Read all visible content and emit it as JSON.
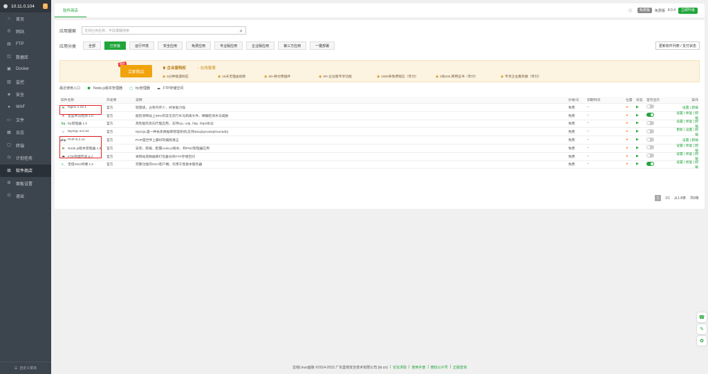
{
  "sidebar": {
    "server_ip": "10.11.0.104",
    "badge": "0",
    "items": [
      {
        "label": "首页",
        "icon": "home-icon",
        "glyph": "⌂"
      },
      {
        "label": "网站",
        "icon": "globe-icon",
        "glyph": "◎"
      },
      {
        "label": "FTP",
        "icon": "ftp-icon",
        "glyph": "▤"
      },
      {
        "label": "数据库",
        "icon": "database-icon",
        "glyph": "◫"
      },
      {
        "label": "Docker",
        "icon": "docker-icon",
        "glyph": "▣"
      },
      {
        "label": "监控",
        "icon": "monitor-icon",
        "glyph": "▥"
      },
      {
        "label": "安全",
        "icon": "shield-icon",
        "glyph": "◈"
      },
      {
        "label": "WAF",
        "icon": "waf-icon",
        "glyph": "●"
      },
      {
        "label": "文件",
        "icon": "folder-icon",
        "glyph": "▭"
      },
      {
        "label": "日志",
        "icon": "log-icon",
        "glyph": "▦"
      },
      {
        "label": "终端",
        "icon": "terminal-icon",
        "glyph": "▢"
      },
      {
        "label": "计划任务",
        "icon": "clock-icon",
        "glyph": "◷"
      },
      {
        "label": "软件商店",
        "icon": "grid-icon",
        "glyph": "▩",
        "active": true
      },
      {
        "label": "面板设置",
        "icon": "gear-icon",
        "glyph": "⚙"
      },
      {
        "label": "退出",
        "icon": "logout-icon",
        "glyph": "⏻"
      }
    ],
    "footer": "自定义菜单"
  },
  "topbar": {
    "tab": "软件商店",
    "edition_badge": "免费版",
    "version_label": "免费版",
    "version": "8.0.4",
    "upgrade": "立即升级"
  },
  "search": {
    "label": "应用搜索",
    "placeholder": "支持应用名称、字段模糊搜索"
  },
  "categories": {
    "label": "应用分类",
    "items": [
      {
        "label": "全部"
      },
      {
        "label": "已安装",
        "active": true
      },
      {
        "label": "运行环境"
      },
      {
        "label": "安全应用"
      },
      {
        "label": "免费应用"
      },
      {
        "label": "专业版应用"
      },
      {
        "label": "企业版应用"
      },
      {
        "label": "第三方应用"
      },
      {
        "label": "一键部署"
      }
    ],
    "refresh": "更新软件列表 / 支付状态"
  },
  "banner": {
    "buy_tag": "限时",
    "buy_label": "立即购买",
    "title1": "企业版特权",
    "title2": "在线客服",
    "features": [
      "5分钟极速响应",
      "15天无理由退款",
      "30+款付费插件",
      "20+企业版专享功能",
      "1000条免费短信（年付）",
      "2张SSL商用证书（年付）",
      "专享企业服务群（年付）"
    ]
  },
  "recent": {
    "label": "最近使用入口",
    "items": [
      {
        "label": "Node.js版本管理器",
        "icon": "nodejs-icon"
      },
      {
        "label": "frp管理器",
        "icon": "frp-icon"
      },
      {
        "label": "FTP存储空间",
        "icon": "cloud-icon"
      }
    ]
  },
  "table": {
    "headers": {
      "name": "软件名称",
      "dev": "开发商",
      "desc": "说明",
      "price": "价格/天",
      "expire": "到期时间",
      "pos": "位置",
      "status": "状态",
      "home": "首页显示",
      "ops": "操作"
    },
    "rows": [
      {
        "name": "Nginx 1.22.1",
        "icon": "nginx-icon",
        "icon_text": "N",
        "icon_color": "#2e9a3e",
        "dev": "官方",
        "desc": "轻量级，占有内存少，并发能力强",
        "price": "免费",
        "expire": "--",
        "home_on": false,
        "ops": "设置 | 卸载"
      },
      {
        "name": "堡垒木马检测 1.0",
        "icon": "trojan-icon",
        "icon_text": "A",
        "icon_color": "#c0392b",
        "dev": "官方",
        "desc": "能检测网站上99%的常见流行木马病毒文件、精确检测木马威胁",
        "price": "免费",
        "expire": "--",
        "home_on": true,
        "ops": "设置 | 修复 | 卸载"
      },
      {
        "name": "frp管理器 1.0",
        "icon": "frp-icon",
        "icon_text": "frp",
        "icon_color": "#20a53a",
        "dev": "官方",
        "desc": "高性能的反向代理应用，支持tcp, udp, http, https协议",
        "price": "免费",
        "expire": "--",
        "home_on": false,
        "ops": "设置 | 修复 | 卸载"
      },
      {
        "name": "MySQL 8.0.34",
        "icon": "mysql-icon",
        "icon_text": "≈",
        "icon_color": "#5b7fa6",
        "dev": "官方",
        "desc": "MySQL是一种关系数据库管理系统(支持alisql/greatsql/mariadb)",
        "price": "免费",
        "expire": "--",
        "home_on": false,
        "ops": "更新 | 设置 | 卸载"
      },
      {
        "name": "PHP-8.2.12",
        "icon": "php-icon",
        "icon_text": "php",
        "icon_color": "#555",
        "dev": "官方",
        "desc": "PHP是世界上最好的编程语言",
        "price": "免费",
        "expire": "--",
        "home_on": false,
        "ops": "设置 | 卸载"
      },
      {
        "name": "Node.js版本管理器 1.9",
        "icon": "nodejs-icon",
        "icon_text": "N",
        "icon_color": "#3c873a",
        "dev": "官方",
        "desc": "安装、卸载、配置node.js版本、和PM2管理器应用",
        "price": "免费",
        "expire": "--",
        "home_on": false,
        "ops": "设置 | 修复 | 卸载"
      },
      {
        "name": "FTP存储空间 5.7",
        "icon": "cloud-icon",
        "icon_text": "☁",
        "icon_color": "#333",
        "dev": "官方",
        "desc": "将网站或数据库打包备份到FTP存储空间",
        "price": "免费",
        "expire": "--",
        "home_on": false,
        "ops": "设置 | 修复 | 卸载"
      },
      {
        "name": "宝塔SSH终端 1.0",
        "icon": "ssh-icon",
        "icon_text": ">_",
        "icon_color": "#20a53a",
        "dev": "官方",
        "desc": "完整功能的SSH客户端，仅用于连接本服务器",
        "price": "免费",
        "expire": "--",
        "home_on": true,
        "ops": "设置 | 修复 | 卸载"
      }
    ]
  },
  "pager": {
    "current": "1",
    "pages": "1/1",
    "range": "从1-8条",
    "total": "共8条"
  },
  "footer": {
    "copyright": "宝塔Linux面板 ©2014-2023 广东堡塔安全技术有限公司 (bt.cn)",
    "links": [
      "论坛求助",
      "使用手册",
      "微信公众号",
      "正版查询"
    ]
  },
  "accent": "#20a53a",
  "highlight": "#e02020"
}
